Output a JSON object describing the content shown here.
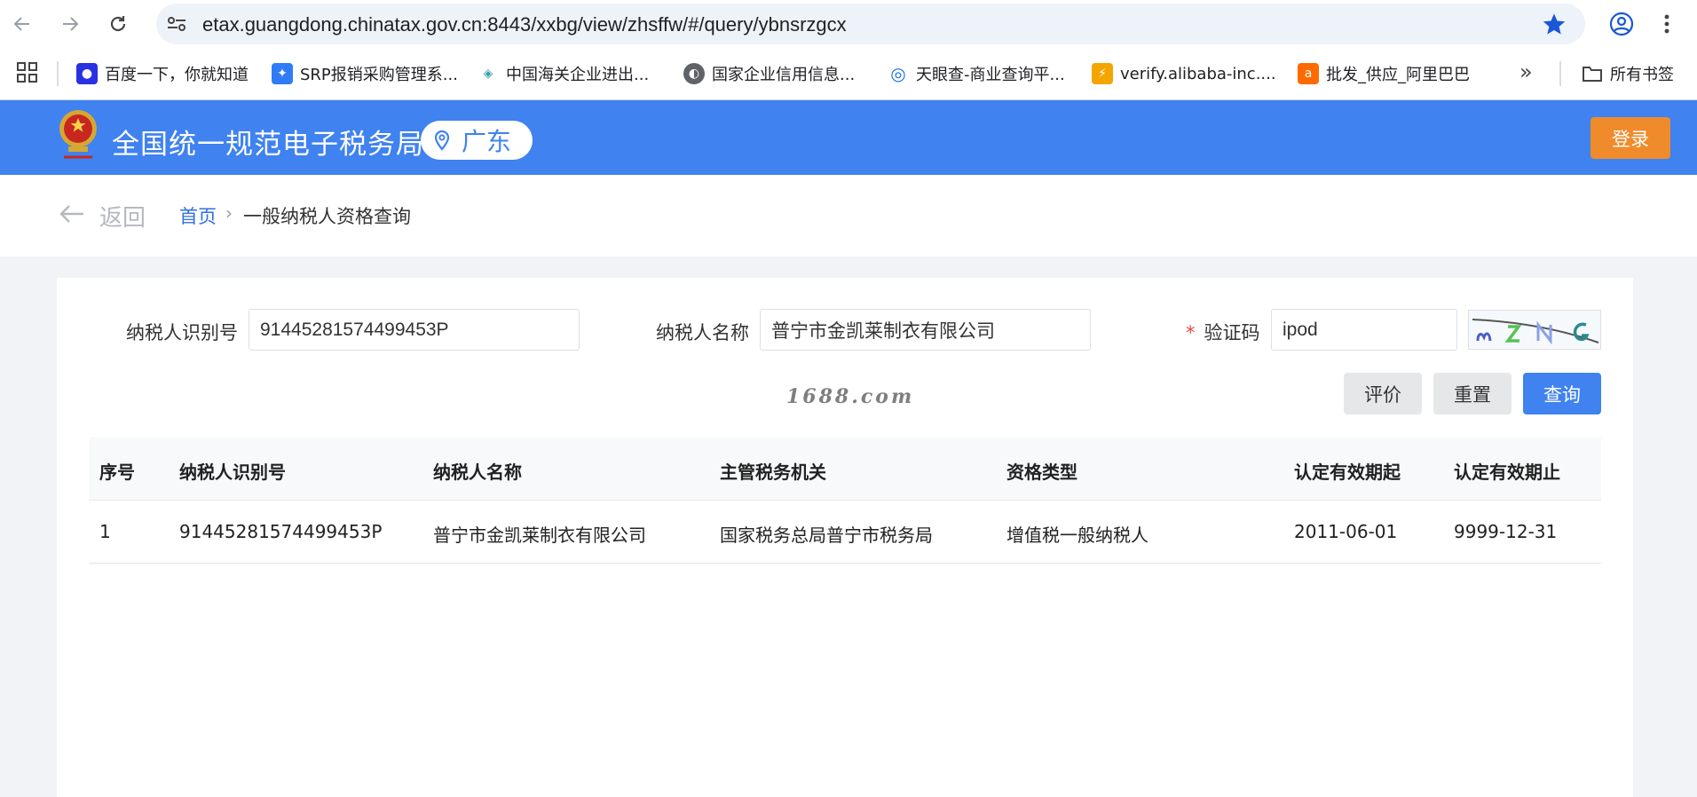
{
  "browser": {
    "url": "etax.guangdong.chinatax.gov.cn:8443/xxbg/view/zhsffw/#/query/ybnsrzgcx",
    "bookmarks": [
      {
        "label": "百度一下，你就知道",
        "icon": "baidu-icon",
        "color": "#2932e1"
      },
      {
        "label": "SRP报销采购管理系...",
        "icon": "srp-icon",
        "color": "#2f7cf6"
      },
      {
        "label": "中国海关企业进出...",
        "icon": "customs-icon",
        "color": "#3aa0a8"
      },
      {
        "label": "国家企业信用信息...",
        "icon": "globe-icon",
        "color": "#5f6368"
      },
      {
        "label": "天眼查-商业查询平...",
        "icon": "tianyancha-icon",
        "color": "#1c6fe6"
      },
      {
        "label": "verify.alibaba-inc....",
        "icon": "alibaba-verify-icon",
        "color": "#f5a500"
      },
      {
        "label": "批发_供应_阿里巴巴",
        "icon": "alibaba-icon",
        "color": "#ff6a00"
      }
    ],
    "all_bookmarks": "所有书签",
    "more": "»"
  },
  "header": {
    "title": "全国统一规范电子税务局",
    "region": "广东",
    "login": "登录",
    "brand_color": "#3f82f0"
  },
  "breadcrumb": {
    "back": "返回",
    "home": "首页",
    "separator": "›",
    "current": "一般纳税人资格查询"
  },
  "form": {
    "taxpayer_id_label": "纳税人识别号",
    "taxpayer_id_value": "91445281574499453P",
    "taxpayer_name_label": "纳税人名称",
    "taxpayer_name_value": "普宁市金凯莱制衣有限公司",
    "required_mark": "*",
    "captcha_label": "验证码",
    "captcha_value": "ipod",
    "buttons": {
      "evaluate": "评价",
      "reset": "重置",
      "query": "查询"
    }
  },
  "watermark": "1688.com",
  "table": {
    "headers": [
      "序号",
      "纳税人识别号",
      "纳税人名称",
      "主管税务机关",
      "资格类型",
      "认定有效期起",
      "认定有效期止"
    ],
    "rows": [
      [
        "1",
        "91445281574499453P",
        "普宁市金凯莱制衣有限公司",
        "国家税务总局普宁市税务局",
        "增值税一般纳税人",
        "2011-06-01",
        "9999-12-31"
      ]
    ]
  }
}
